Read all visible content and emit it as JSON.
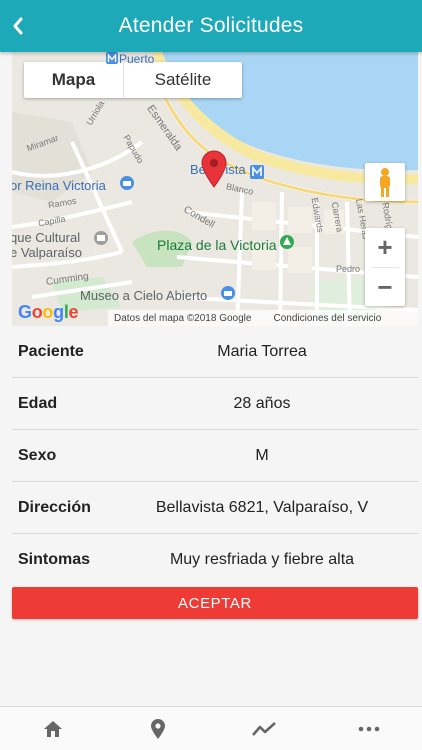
{
  "header": {
    "title": "Atender Solicitudes",
    "back_icon": "chevron-left-icon"
  },
  "map": {
    "type_control": {
      "map_label": "Mapa",
      "satellite_label": "Satélite"
    },
    "labels": {
      "puerto": "Puerto",
      "bellavista": "Bellavista",
      "reina_victoria": "or Reina Victoria",
      "plaza_victoria": "Plaza de la Victoria",
      "centro_cultural_1": "que Cultural",
      "centro_cultural_2": "e Valparaíso",
      "museo": "Museo a Cielo Abierto",
      "esmeralda": "Esmeralda",
      "blanco": "Blanco",
      "condell": "Condell",
      "cumming": "Cumming",
      "urriola": "Urriola",
      "papudo": "Papudo",
      "miramar": "Miramar",
      "ramos": "Ramos",
      "capilla": "Capilla",
      "edwards": "Edwards",
      "carrera": "Carrera",
      "las_heras": "Las Heras",
      "rodriguez": "Rodríguez",
      "pedro": "Pedro"
    },
    "google_logo": "Google",
    "attribution": "Datos del mapa ©2018 Google",
    "terms": "Condiciones del servicio",
    "zoom_in": "+",
    "zoom_out": "−"
  },
  "details": [
    {
      "label": "Paciente",
      "value": "Maria Torrea"
    },
    {
      "label": "Edad",
      "value": "28 años"
    },
    {
      "label": "Sexo",
      "value": "M"
    },
    {
      "label": "Dirección",
      "value": "Bellavista 6821, Valparaíso, V"
    },
    {
      "label": "Sintomas",
      "value": "Muy resfriada y fiebre alta"
    }
  ],
  "accept_button": "ACEPTAR",
  "bottom_nav": [
    {
      "icon": "home-icon"
    },
    {
      "icon": "location-pin-icon"
    },
    {
      "icon": "trending-icon"
    },
    {
      "icon": "more-dots-icon"
    }
  ],
  "colors": {
    "header": "#1ea9b8",
    "accept": "#ef3b35",
    "marker": "#e8333a"
  }
}
